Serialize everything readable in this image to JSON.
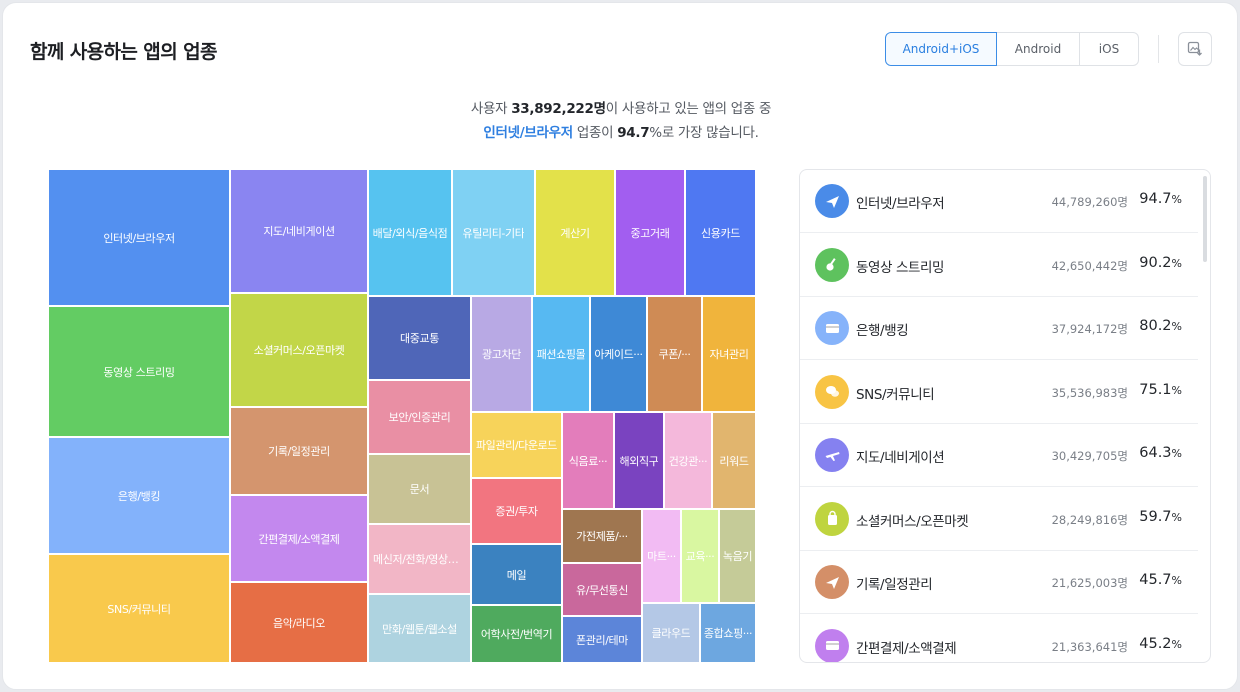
{
  "header": {
    "title": "함께 사용하는 앱의 업종"
  },
  "filters": {
    "both": "Android+iOS",
    "android": "Android",
    "ios": "iOS",
    "selected": "Android+iOS"
  },
  "summary": {
    "line1_prefix": "사용자 ",
    "user_count": "33,892,222명",
    "line1_suffix": "이 사용하고 있는 앱의 업종 중",
    "top_category": "인터넷/브라우저",
    "line2_mid": " 업종이 ",
    "top_percent": "94.7",
    "line2_suffix": "%로 가장 많습니다."
  },
  "treemap": {
    "tiles": [
      {
        "label": "인터넷/브라우저",
        "color": "#5390f0"
      },
      {
        "label": "동영상 스트리밍",
        "color": "#63cc63"
      },
      {
        "label": "은행/뱅킹",
        "color": "#83b2fb"
      },
      {
        "label": "SNS/커뮤니티",
        "color": "#f9c94c"
      },
      {
        "label": "지도/네비게이션",
        "color": "#8a85f1"
      },
      {
        "label": "소셜커머스/오픈마켓",
        "color": "#c2d648"
      },
      {
        "label": "기록/일정관리",
        "color": "#d4956e"
      },
      {
        "label": "간편결제/소액결제",
        "color": "#c388ee"
      },
      {
        "label": "음악/라디오",
        "color": "#e66e45"
      },
      {
        "label": "배달/외식/음식점",
        "color": "#56c3f0"
      },
      {
        "label": "유틸리티-기타",
        "color": "#7fd1f3"
      },
      {
        "label": "계산기",
        "color": "#e3e14a"
      },
      {
        "label": "중고거래",
        "color": "#a25ef0"
      },
      {
        "label": "신용카드",
        "color": "#4f78f2"
      },
      {
        "label": "대중교통",
        "color": "#4f66b8"
      },
      {
        "label": "광고차단",
        "color": "#b8a9e4"
      },
      {
        "label": "패션쇼핑몰",
        "color": "#57b9f2"
      },
      {
        "label": "아케이드···",
        "color": "#3e89d6"
      },
      {
        "label": "쿠폰/···",
        "color": "#cf8b55"
      },
      {
        "label": "자녀관리",
        "color": "#f0b43c"
      },
      {
        "label": "보안/인증관리",
        "color": "#e98fa4"
      },
      {
        "label": "문서",
        "color": "#c8c295"
      },
      {
        "label": "메신저/전화/영상통화",
        "color": "#f2b6c6"
      },
      {
        "label": "만화/웹툰/웹소설",
        "color": "#aed3e0"
      },
      {
        "label": "파일관리/다운로드",
        "color": "#f7d35a"
      },
      {
        "label": "증권/투자",
        "color": "#f27580"
      },
      {
        "label": "메일",
        "color": "#3b82c0"
      },
      {
        "label": "어학사전/번역기",
        "color": "#4faa5e"
      },
      {
        "label": "식음료···",
        "color": "#e37dbb"
      },
      {
        "label": "해외직구",
        "color": "#7a43c0"
      },
      {
        "label": "건강관···",
        "color": "#f4b8db"
      },
      {
        "label": "리워드",
        "color": "#e1b56e"
      },
      {
        "label": "가전제품/···",
        "color": "#9f7650"
      },
      {
        "label": "마트···",
        "color": "#f2bbf3"
      },
      {
        "label": "교육···",
        "color": "#d9f7a1"
      },
      {
        "label": "녹음기",
        "color": "#c5cb98"
      },
      {
        "label": "유/무선통신",
        "color": "#c9689c"
      },
      {
        "label": "폰관리/테마",
        "color": "#5c85d9"
      },
      {
        "label": "클라우드",
        "color": "#b4c8e6"
      },
      {
        "label": "종합쇼핑···",
        "color": "#6da7e0"
      }
    ]
  },
  "ranking": [
    {
      "name": "인터넷/브라우저",
      "count": "44,789,260명",
      "pct": "94.7",
      "icon": "paper-plane-icon",
      "color": "#4a8be8"
    },
    {
      "name": "동영상 스트리밍",
      "count": "42,650,442명",
      "pct": "90.2",
      "icon": "guitar-icon",
      "color": "#5ec25e"
    },
    {
      "name": "은행/뱅킹",
      "count": "37,924,172명",
      "pct": "80.2",
      "icon": "card-icon",
      "color": "#86b3fa"
    },
    {
      "name": "SNS/커뮤니티",
      "count": "35,536,983명",
      "pct": "75.1",
      "icon": "chat-icon",
      "color": "#f8c444"
    },
    {
      "name": "지도/네비게이션",
      "count": "30,429,705명",
      "pct": "64.3",
      "icon": "airplane-icon",
      "color": "#8581f0"
    },
    {
      "name": "소셜커머스/오픈마켓",
      "count": "28,249,816명",
      "pct": "59.7",
      "icon": "shopping-bag-icon",
      "color": "#bfd43f"
    },
    {
      "name": "기록/일정관리",
      "count": "21,625,003명",
      "pct": "45.7",
      "icon": "paper-plane-icon",
      "color": "#d48f68"
    },
    {
      "name": "간편결제/소액결제",
      "count": "21,363,641명",
      "pct": "45.2",
      "icon": "card-icon",
      "color": "#c07fee"
    }
  ]
}
